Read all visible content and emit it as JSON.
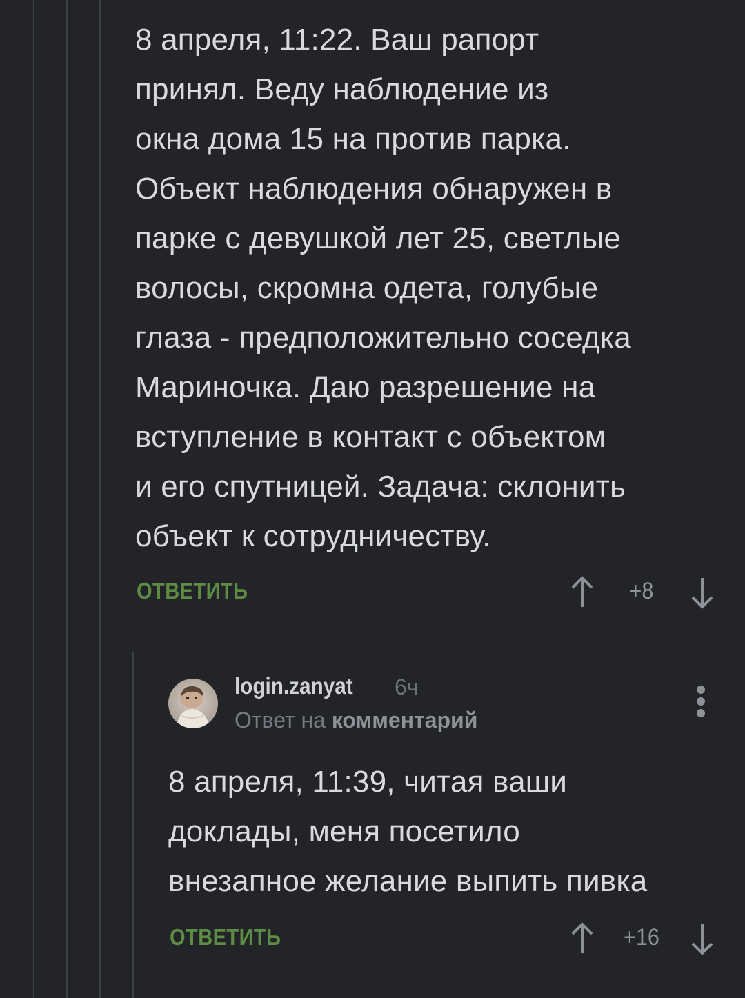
{
  "comment_parent": {
    "text": "8 апреля, 11:22. Ваш рапорт\nпринял. Веду наблюдение из\nокна дома 15 на против парка.\nОбъект наблюдения обнаружен в\nпарке с девушкой лет 25, светлые\nволосы, скромна одета, голубые\nглаза - предположительно соседка\nМариночка. Даю разрешение на\nвступление в контакт с объектом\nи его спутницей. Задача: склонить\nобъект к сотрудничеству.",
    "reply_label": "ОТВЕТИТЬ",
    "score": "+8"
  },
  "comment_reply": {
    "username": "login.zanyat",
    "time": "6ч",
    "reply_to_prefix": "Ответ на",
    "reply_to_link": "комментарий",
    "text": "8 апреля, 11:39, читая ваши\nдоклады, меня посетило\nвнезапное желание выпить пивка",
    "reply_label": "ОТВЕТИТЬ",
    "score": "+16"
  },
  "icons": {
    "upvote": "arrow-up-icon",
    "downvote": "arrow-down-icon",
    "more": "more-vertical-icon",
    "avatar": "avatar-photo"
  },
  "colors": {
    "background": "#222428",
    "text": "#d9dadd",
    "reply_button": "#5d8c45",
    "muted": "#8e9197",
    "thread_line": "#3d4046"
  }
}
